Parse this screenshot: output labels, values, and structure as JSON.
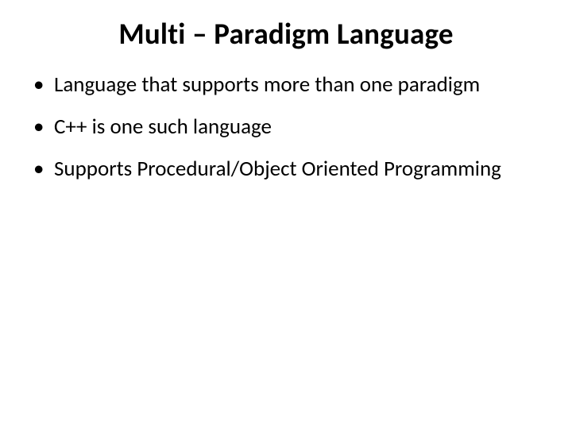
{
  "slide": {
    "title": "Multi – Paradigm Language",
    "bullets": [
      "Language that supports more than one paradigm",
      "C++ is one such language",
      "Supports Procedural/Object Oriented Programming"
    ]
  }
}
